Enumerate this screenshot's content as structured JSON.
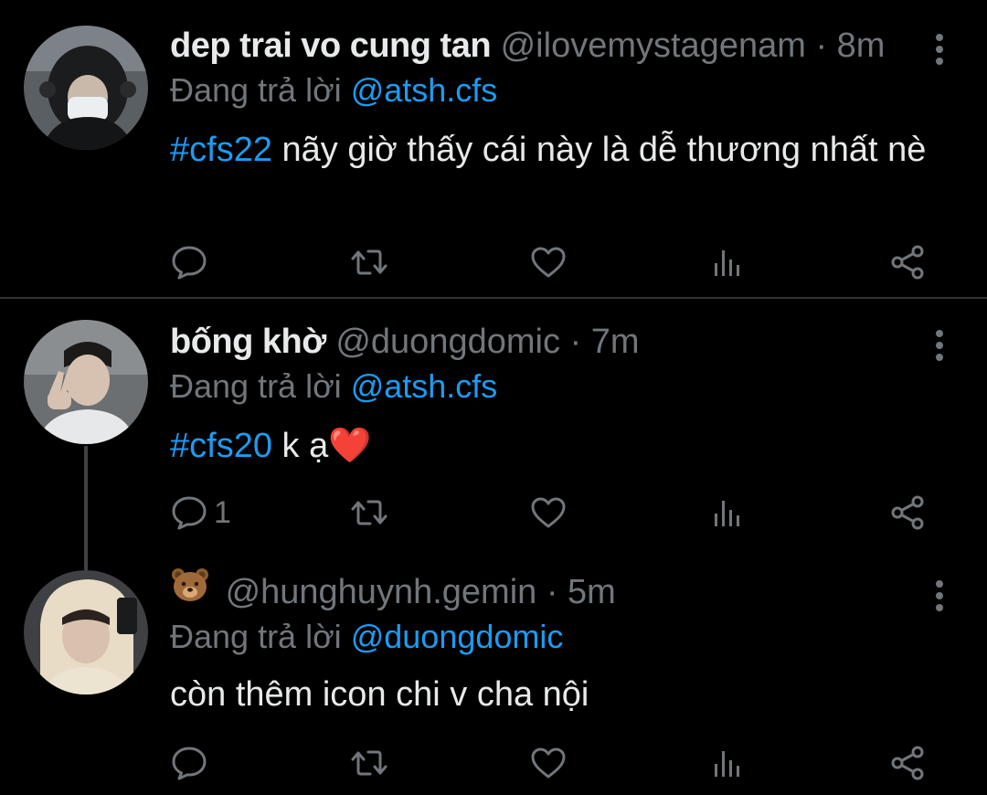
{
  "tweets": [
    {
      "display_name": "dep trai vo cung tan",
      "handle": "@ilovemystagenam",
      "separator": "·",
      "time": "8m",
      "replying_prefix": "Đang trả lời",
      "replying_to": "@atsh.cfs",
      "hashtag": "#cfs22",
      "text": " nãy giờ thấy cái này là dễ thương nhất nè",
      "reply_count": "",
      "avatar_icon": "user-avatar-hoodie-headphones"
    },
    {
      "display_name": "bống khờ",
      "handle": "@duongdomic",
      "separator": "·",
      "time": "7m",
      "replying_prefix": "Đang trả lời",
      "replying_to": "@atsh.cfs",
      "hashtag": "#cfs20",
      "text": " k ạ",
      "text_emoji": "❤️",
      "reply_count": "1",
      "avatar_icon": "user-avatar-peace-sign"
    },
    {
      "display_name_emoji": "🐻",
      "handle": "@hunghuynh.gemin",
      "separator": "·",
      "time": "5m",
      "replying_prefix": "Đang trả lời",
      "replying_to": "@duongdomic",
      "text": "còn thêm icon chi v cha nội",
      "reply_count": "",
      "avatar_icon": "user-avatar-hood"
    }
  ],
  "colors": {
    "background": "#000000",
    "text": "#e7e9ea",
    "muted": "#71767b",
    "accent": "#1d9bf0",
    "divider": "#2f3336",
    "heart_emoji": "#e0245e"
  },
  "icons": {
    "reply": "reply-icon",
    "retweet": "retweet-icon",
    "like": "heart-icon",
    "views": "analytics-icon",
    "share": "share-icon",
    "more": "more-vertical-icon"
  }
}
